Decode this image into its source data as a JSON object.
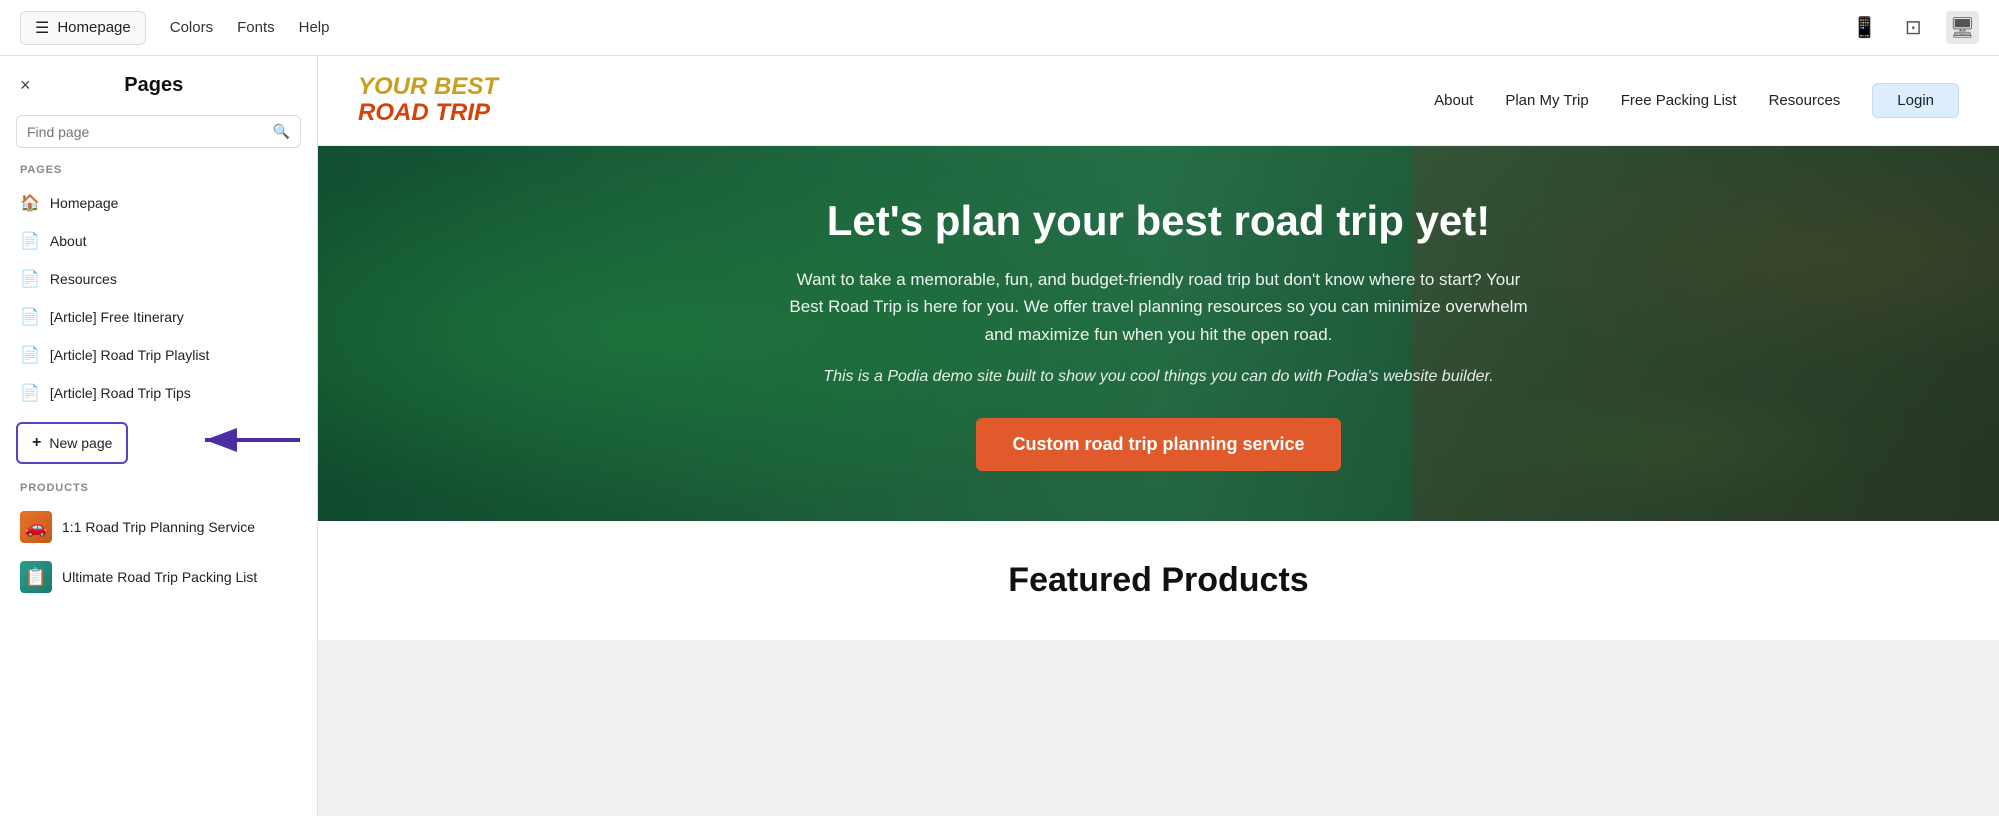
{
  "topbar": {
    "homepage_label": "Homepage",
    "colors_label": "Colors",
    "fonts_label": "Fonts",
    "help_label": "Help",
    "devices": [
      "mobile-icon",
      "tablet-icon",
      "desktop-icon"
    ]
  },
  "sidebar": {
    "close_label": "×",
    "title": "Pages",
    "search_placeholder": "Find page",
    "sections": {
      "pages_label": "PAGES",
      "products_label": "PRODUCTS"
    },
    "pages": [
      {
        "name": "Homepage",
        "icon": "home"
      },
      {
        "name": "About",
        "icon": "doc"
      },
      {
        "name": "Resources",
        "icon": "doc"
      },
      {
        "name": "[Article] Free Itinerary",
        "icon": "doc"
      },
      {
        "name": "[Article] Road Trip Playlist",
        "icon": "doc"
      },
      {
        "name": "[Article] Road Trip Tips",
        "icon": "doc"
      }
    ],
    "new_page_label": "New page",
    "products": [
      {
        "name": "1:1 Road Trip Planning Service",
        "color": "orange"
      },
      {
        "name": "Ultimate Road Trip Packing List",
        "color": "teal"
      }
    ]
  },
  "website": {
    "logo_line1": "YOUR BEST",
    "logo_line2": "ROAD TRIP",
    "nav": {
      "about": "About",
      "plan": "Plan My Trip",
      "packing": "Free Packing List",
      "resources": "Resources",
      "login": "Login"
    },
    "hero": {
      "title": "Let's plan your best road trip yet!",
      "subtitle": "Want to take a memorable, fun, and budget-friendly road trip but don't know where to start? Your Best Road Trip is here for you. We offer travel planning resources so you can minimize overwhelm and maximize fun when you hit the open road.",
      "note": "This is a Podia demo site built to show you cool things you can do with Podia's website builder.",
      "cta": "Custom road trip planning service"
    },
    "featured": {
      "title": "Featured Products"
    }
  }
}
